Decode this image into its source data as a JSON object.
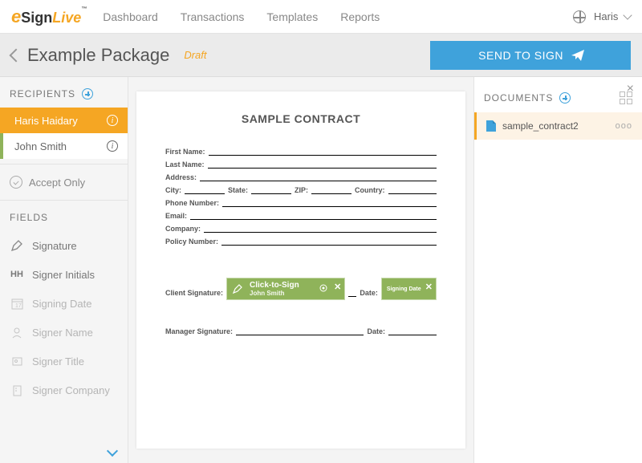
{
  "nav": {
    "dashboard": "Dashboard",
    "transactions": "Transactions",
    "templates": "Templates",
    "reports": "Reports",
    "username": "Haris"
  },
  "titlebar": {
    "package_name": "Example Package",
    "status": "Draft",
    "send_label": "SEND TO SIGN"
  },
  "recipients": {
    "header": "RECIPIENTS",
    "items": [
      {
        "name": "Haris Haidary",
        "active": true
      },
      {
        "name": "John Smith",
        "active": false
      }
    ],
    "accept_only": "Accept Only"
  },
  "fields": {
    "header": "FIELDS",
    "items": [
      {
        "label": "Signature",
        "enabled": true,
        "icon": "pen"
      },
      {
        "label": "Signer Initials",
        "enabled": true,
        "icon": "HH"
      },
      {
        "label": "Signing Date",
        "enabled": false,
        "icon": "cal"
      },
      {
        "label": "Signer Name",
        "enabled": false,
        "icon": "person"
      },
      {
        "label": "Signer Title",
        "enabled": false,
        "icon": "badge"
      },
      {
        "label": "Signer Company",
        "enabled": false,
        "icon": "building"
      }
    ]
  },
  "document": {
    "title": "SAMPLE CONTRACT",
    "labels": {
      "first_name": "First Name:",
      "last_name": "Last Name:",
      "address": "Address:",
      "city": "City:",
      "state": "State:",
      "zip": "ZIP:",
      "country": "Country:",
      "phone": "Phone Number:",
      "email": "Email:",
      "company": "Company:",
      "policy": "Policy Number:",
      "client_sig": "Client Signature:",
      "date": "Date:",
      "mgr_sig": "Manager Signature:"
    },
    "sig_block": {
      "main": "Click-to-Sign",
      "sub": "John Smith",
      "date_label": "Signing Date"
    }
  },
  "documents_panel": {
    "header": "DOCUMENTS",
    "items": [
      {
        "name": "sample_contract2"
      }
    ]
  }
}
